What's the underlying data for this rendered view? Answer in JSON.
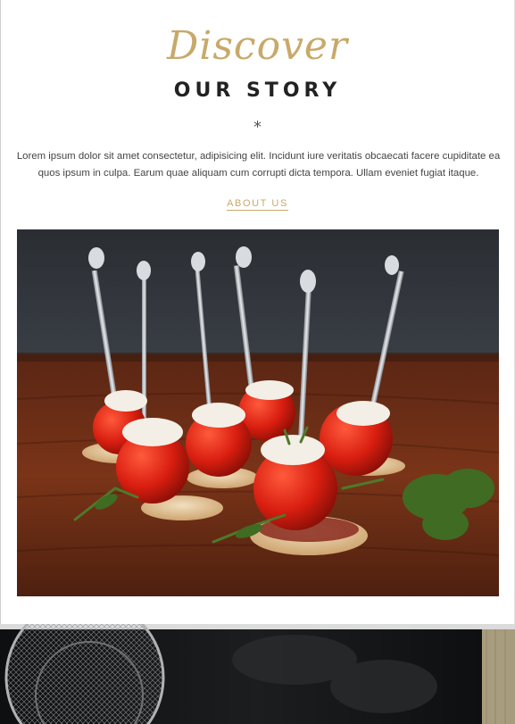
{
  "story": {
    "script_title": "Discover",
    "title": "OUR STORY",
    "divider": "*",
    "intro": "Lorem ipsum dolor sit amet consectetur, adipisicing elit. Incidunt iure veritatis obcaecati facere cupiditate ea quos ipsum in culpa. Earum quae aliquam cum corrupti dicta tempora. Ullam eveniet fugiat itaque.",
    "about_link": "ABOUT US"
  },
  "colors": {
    "accent": "#c8a96a",
    "heading": "#222222",
    "body_text": "#444444",
    "tomato": "#d92417",
    "wood": "#6a2c17"
  },
  "images": {
    "food_photo": "tomato-appetizer-skewers-photo",
    "dark_band": "kitchen-utensils-dark-photo"
  }
}
